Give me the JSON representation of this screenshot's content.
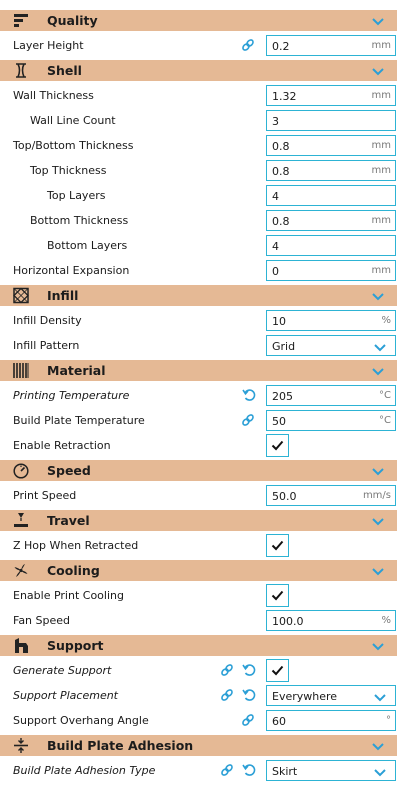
{
  "categories": {
    "quality": {
      "label": "Quality",
      "icon": "quality-icon"
    },
    "shell": {
      "label": "Shell",
      "icon": "shell-icon"
    },
    "infill": {
      "label": "Infill",
      "icon": "infill-icon"
    },
    "material": {
      "label": "Material",
      "icon": "material-icon"
    },
    "speed": {
      "label": "Speed",
      "icon": "speed-icon"
    },
    "travel": {
      "label": "Travel",
      "icon": "travel-icon"
    },
    "cooling": {
      "label": "Cooling",
      "icon": "cooling-icon"
    },
    "support": {
      "label": "Support",
      "icon": "support-icon"
    },
    "adhesion": {
      "label": "Build Plate Adhesion",
      "icon": "build-plate-adhesion-icon"
    }
  },
  "settings": {
    "layer_height": {
      "label": "Layer Height",
      "value": "0.2",
      "unit": "mm"
    },
    "wall_thickness": {
      "label": "Wall Thickness",
      "value": "1.32",
      "unit": "mm"
    },
    "wall_line_count": {
      "label": "Wall Line Count",
      "value": "3"
    },
    "top_bottom_thickness": {
      "label": "Top/Bottom Thickness",
      "value": "0.8",
      "unit": "mm"
    },
    "top_thickness": {
      "label": "Top Thickness",
      "value": "0.8",
      "unit": "mm"
    },
    "top_layers": {
      "label": "Top Layers",
      "value": "4"
    },
    "bottom_thickness": {
      "label": "Bottom Thickness",
      "value": "0.8",
      "unit": "mm"
    },
    "bottom_layers": {
      "label": "Bottom Layers",
      "value": "4"
    },
    "horizontal_expansion": {
      "label": "Horizontal Expansion",
      "value": "0",
      "unit": "mm"
    },
    "infill_density": {
      "label": "Infill Density",
      "value": "10",
      "unit": "%"
    },
    "infill_pattern": {
      "label": "Infill Pattern",
      "value": "Grid"
    },
    "printing_temperature": {
      "label": "Printing Temperature",
      "value": "205",
      "unit": "°C"
    },
    "build_plate_temperature": {
      "label": "Build Plate Temperature",
      "value": "50",
      "unit": "°C"
    },
    "enable_retraction": {
      "label": "Enable Retraction",
      "checked": true
    },
    "print_speed": {
      "label": "Print Speed",
      "value": "50.0",
      "unit": "mm/s"
    },
    "z_hop": {
      "label": "Z Hop When Retracted",
      "checked": true
    },
    "enable_print_cooling": {
      "label": "Enable Print Cooling",
      "checked": true
    },
    "fan_speed": {
      "label": "Fan Speed",
      "value": "100.0",
      "unit": "%"
    },
    "generate_support": {
      "label": "Generate Support",
      "checked": true
    },
    "support_placement": {
      "label": "Support Placement",
      "value": "Everywhere"
    },
    "support_overhang_angle": {
      "label": "Support Overhang Angle",
      "value": "60",
      "unit": "°"
    },
    "adhesion_type": {
      "label": "Build Plate Adhesion Type",
      "value": "Skirt"
    }
  },
  "colors": {
    "category_bg": "#e5b995",
    "field_border": "#2db3d4",
    "link_icon": "#2b9fd6"
  }
}
